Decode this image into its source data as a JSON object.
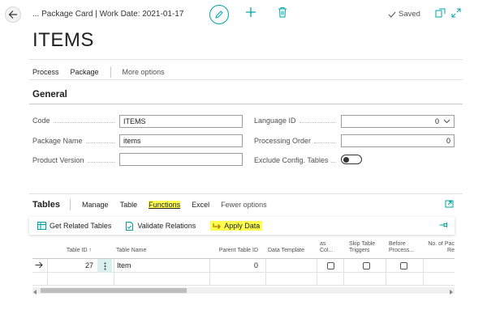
{
  "header": {
    "breadcrumb": "... Package Card | Work Date: 2021-01-17",
    "saved_label": "Saved",
    "page_title": "ITEMS"
  },
  "action_bar": {
    "items": [
      "Process",
      "Package",
      "More options"
    ]
  },
  "general": {
    "title": "General",
    "code_label": "Code",
    "code_value": "ITEMS",
    "package_name_label": "Package Name",
    "package_name_value": "items",
    "product_version_label": "Product Version",
    "product_version_value": "",
    "language_id_label": "Language ID",
    "language_id_value": "0",
    "processing_order_label": "Processing Order",
    "processing_order_value": "0",
    "exclude_config_label": "Exclude Config. Tables"
  },
  "tables": {
    "title": "Tables",
    "tabs": [
      "Manage",
      "Table",
      "Functions",
      "Excel",
      "Fewer options"
    ],
    "actions": [
      "Get Related Tables",
      "Validate Relations",
      "Apply Data"
    ],
    "columns": {
      "table_id": "Table ID ↑",
      "table_name": "Table Name",
      "parent_table_id": "Parent Table ID",
      "data_template": "Data Template",
      "as_col": "as\nCol...",
      "skip_triggers": "Skip Table\nTriggers",
      "before_process": "Before\nProcess...",
      "no_of_pac": "No. of Pac\nRe"
    },
    "rows": [
      {
        "table_id": "27",
        "table_name": "Item",
        "parent_table_id": "0"
      }
    ]
  },
  "colors": {
    "accent": "#00a3a3",
    "highlight": "#ffff4d"
  }
}
